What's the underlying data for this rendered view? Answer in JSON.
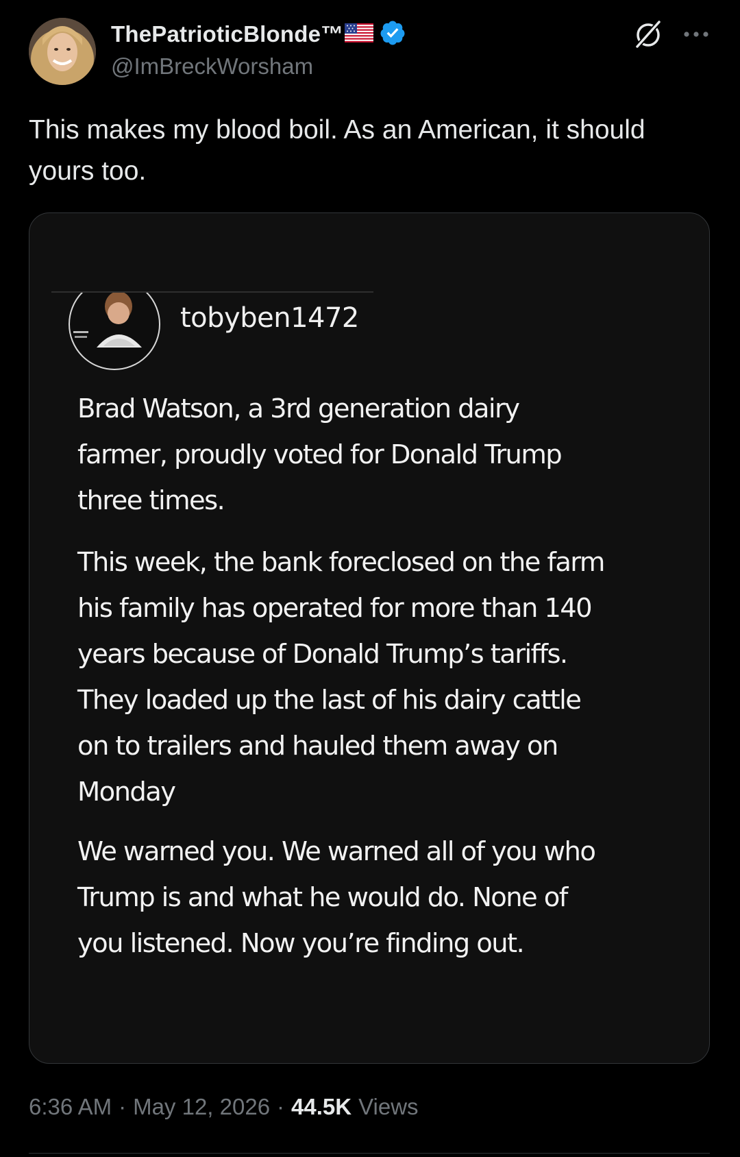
{
  "author": {
    "display_name": "ThePatrioticBlonde™",
    "handle": "@ImBreckWorsham",
    "verified_color": "#1d9bf0"
  },
  "tweet": {
    "text_lines": [
      "This makes my blood boil. As an American, it should",
      "yours too."
    ]
  },
  "embedded_post": {
    "username": "tobyben1472",
    "paragraphs": [
      {
        "lines": [
          "Brad Watson, a 3rd generation dairy",
          "farmer, proudly voted for Donald Trump",
          "three times."
        ]
      },
      {
        "lines": [
          "This week, the bank foreclosed on the farm",
          "his family has operated for more than 140",
          "years because of Donald Trump’s tariffs.",
          "They loaded up the last of his dairy cattle",
          "on to trailers and hauled them away on",
          "Monday"
        ]
      },
      {
        "lines": [
          "We warned you. We warned all of you who",
          "Trump is and what he would do. None of",
          "you listened. Now you’re finding out."
        ]
      }
    ]
  },
  "meta": {
    "time": "6:36 AM",
    "separator": "·",
    "date": "May 12, 2026",
    "views_count": "44.5K",
    "views_label": "Views"
  },
  "icons": {
    "grok": "grok-icon",
    "more": "more-options-icon",
    "verified": "verified-badge-icon",
    "flag": "us-flag-icon"
  }
}
